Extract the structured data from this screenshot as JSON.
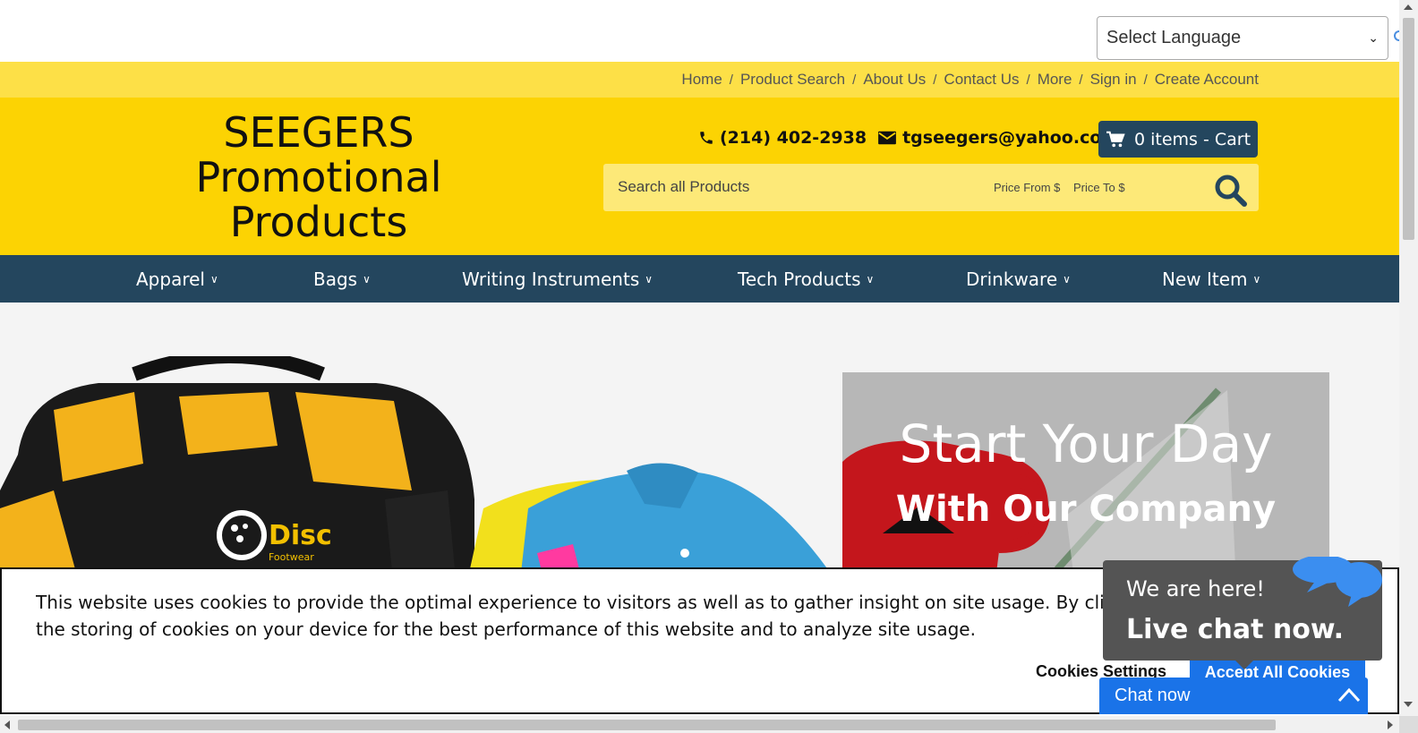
{
  "language_select": {
    "selected": "Select Language"
  },
  "top_links": [
    {
      "label": "Home"
    },
    {
      "label": "Product Search"
    },
    {
      "label": "About Us"
    },
    {
      "label": "Contact Us"
    },
    {
      "label": "More"
    },
    {
      "label": "Sign in"
    },
    {
      "label": "Create Account"
    }
  ],
  "header": {
    "logo_lines": [
      "SEEGERS",
      "Promotional",
      "Products"
    ],
    "phone": "(214) 402-2938",
    "email": "tgseegers@yahoo.com",
    "cart_label": "0 items - Cart"
  },
  "search": {
    "placeholder": "Search all Products",
    "price_from": "Price From $",
    "price_to": "Price To $"
  },
  "categories": [
    {
      "label": "Apparel"
    },
    {
      "label": "Bags"
    },
    {
      "label": "Writing Instruments"
    },
    {
      "label": "Tech Products"
    },
    {
      "label": "Drinkware"
    },
    {
      "label": "New Item"
    }
  ],
  "hero": {
    "title": "Start Your Day",
    "subtitle": "With Our Company",
    "bag_logo": "Disc",
    "bag_logo_sub": "Footwear"
  },
  "cookie": {
    "line1": "This website uses cookies to provide the optimal experience to visitors as well as to gather insight on site usage. By clicking “Accept All Cookies” you agree to",
    "line2": "the storing of cookies on your device for the best performance of this website and to analyze site usage.",
    "settings_label": "Cookies Settings",
    "accept_label": "Accept All Cookies"
  },
  "chat": {
    "line1": "We are here!",
    "line2": "Live chat now.",
    "bar_label": "Chat now"
  },
  "colors": {
    "header_yellow": "#fcd303",
    "strip_yellow": "#fde047",
    "navy": "#24465e",
    "chat_blue": "#1a73e8"
  }
}
